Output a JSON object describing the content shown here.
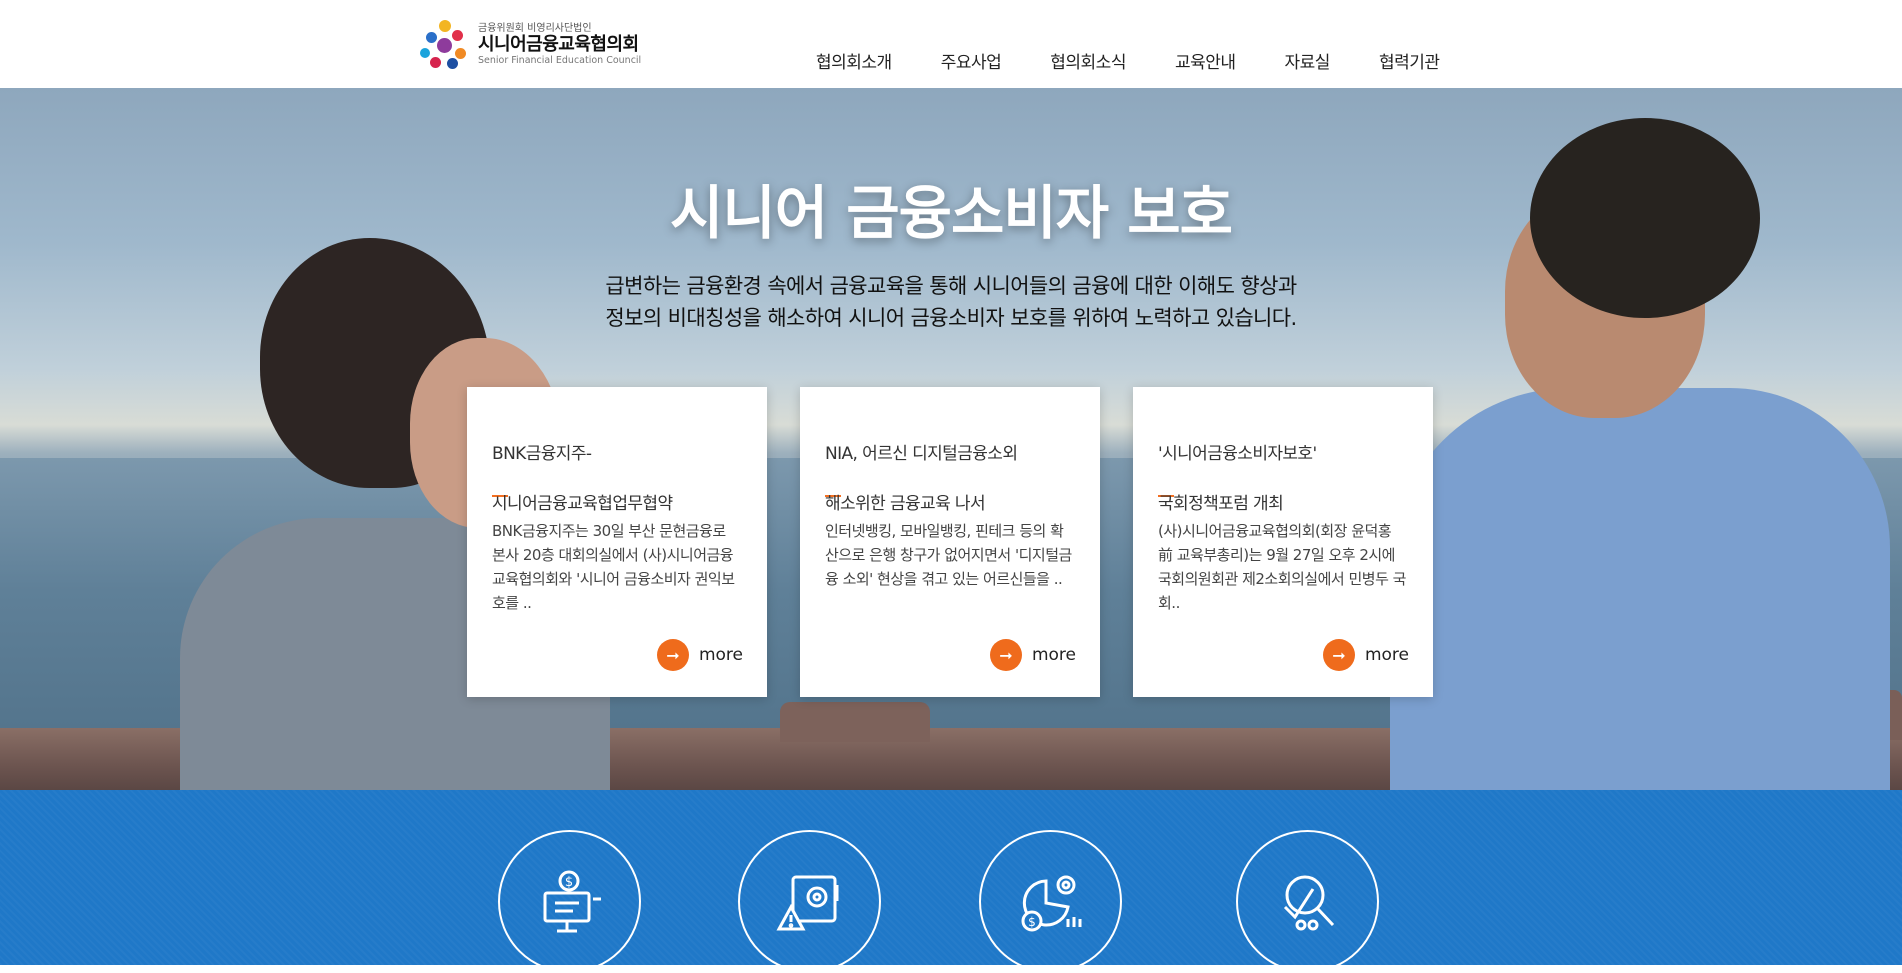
{
  "header": {
    "logo": {
      "sub": "금융위원회 비영리사단법인",
      "name": "시니어금융교육협의회",
      "en": "Senior Financial Education Council"
    },
    "nav": [
      {
        "label": "협의회소개"
      },
      {
        "label": "주요사업"
      },
      {
        "label": "협의회소식"
      },
      {
        "label": "교육안내"
      },
      {
        "label": "자료실"
      },
      {
        "label": "협력기관"
      }
    ]
  },
  "hero": {
    "title": "시니어 금융소비자 보호",
    "desc_line1": "급변하는 금융환경 속에서 금융교육을 통해 시니어들의 금융에 대한 이해도 향상과",
    "desc_line2": "정보의 비대칭성을 해소하여 시니어 금융소비자 보호를 위하여 노력하고 있습니다."
  },
  "cards": [
    {
      "title_line1": "BNK금융지주-",
      "title_line2": "시니어금융교육협업무협약",
      "text": "BNK금융지주는 30일 부산 문현금융로 본사 20층 대회의실에서 (사)시니어금융교육협의회와 '시니어 금융소비자 권익보호를 ..",
      "more": "more"
    },
    {
      "title_line1": "NIA, 어르신 디지털금융소외",
      "title_line2": "해소위한 금융교육 나서",
      "text": "인터넷뱅킹, 모바일뱅킹, 핀테크 등의 확산으로 은행 창구가 없어지면서 '디지털금융 소외' 현상을 겪고 있는 어르신들을 ..",
      "more": "more"
    },
    {
      "title_line1": "'시니어금융소비자보호'",
      "title_line2": "국회정책포럼 개최",
      "text": "(사)시니어금융교육협의회(회장 윤덕홍 前 교육부총리)는 9월 27일 오후 2시에 국회의원회관 제2소회의실에서 민병두 국회..",
      "more": "more"
    }
  ],
  "services": [
    {
      "icon": "online-finance-icon"
    },
    {
      "icon": "safe-warning-icon"
    },
    {
      "icon": "finance-settings-chart-icon"
    },
    {
      "icon": "magnifier-checklist-icon"
    }
  ],
  "colors": {
    "accent": "#ef6b1c",
    "blue": "#1f78c8"
  }
}
